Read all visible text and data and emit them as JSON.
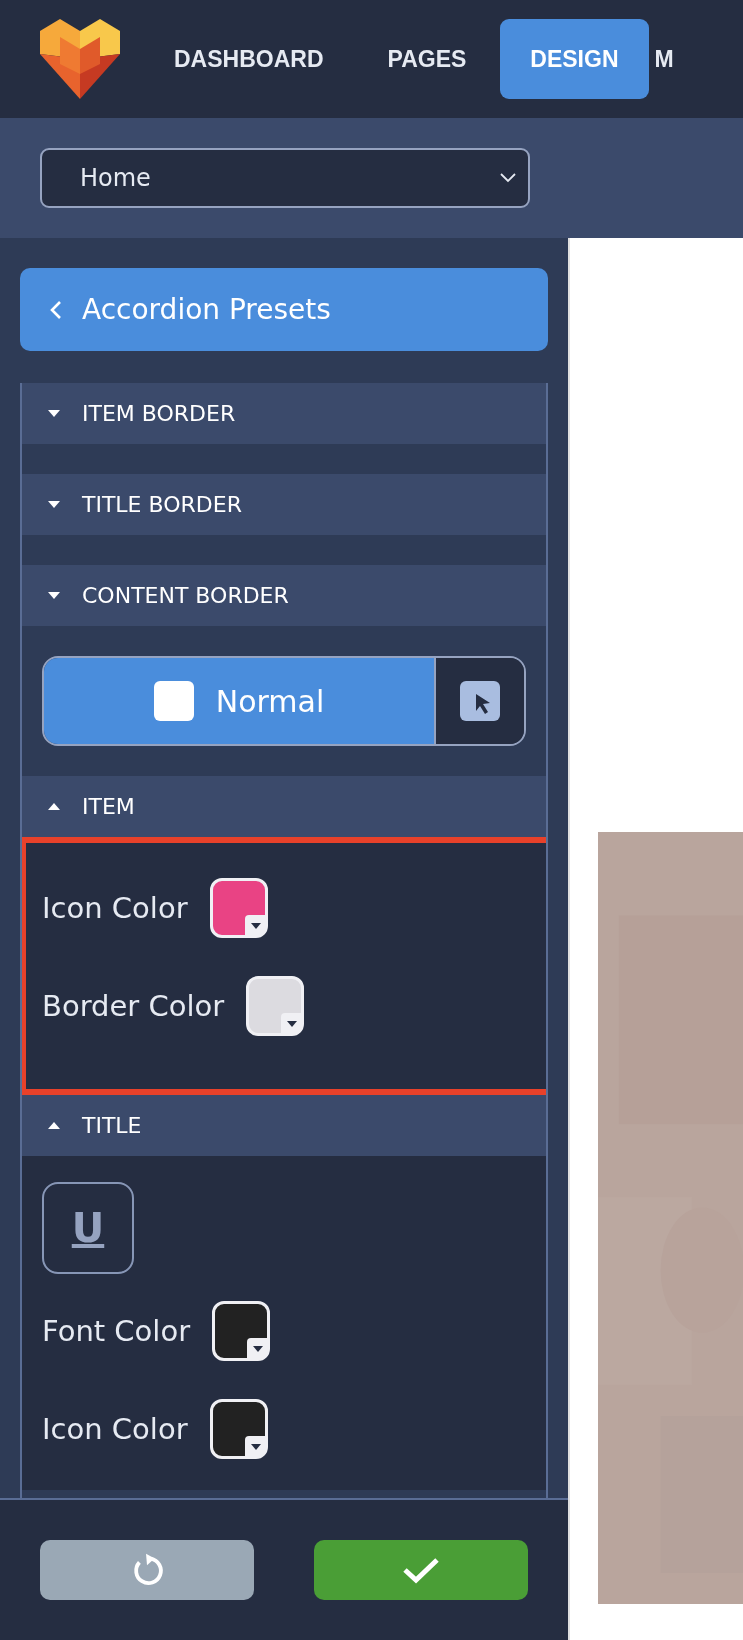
{
  "nav": {
    "items": [
      {
        "label": "DASHBOARD",
        "selected": false
      },
      {
        "label": "PAGES",
        "selected": false
      },
      {
        "label": "DESIGN",
        "selected": true
      },
      {
        "label": "M",
        "selected": false
      }
    ]
  },
  "page_select": {
    "value": "Home"
  },
  "back_button": {
    "label": "Accordion Presets"
  },
  "panel": [
    {
      "kind": "section",
      "title": "ITEM BORDER",
      "expanded": false
    },
    {
      "kind": "section",
      "title": "TITLE BORDER",
      "expanded": false
    },
    {
      "kind": "section",
      "title": "CONTENT BORDER",
      "expanded": false
    },
    {
      "kind": "state_toggle",
      "label": "Normal"
    },
    {
      "kind": "section",
      "title": "ITEM",
      "expanded": true,
      "highlighted": true,
      "controls": [
        {
          "kind": "color",
          "label": "Icon Color",
          "color": "#e94384"
        },
        {
          "kind": "color",
          "label": "Border Color",
          "color": "#dcdbe0"
        }
      ]
    },
    {
      "kind": "section",
      "title": "TITLE",
      "expanded": true,
      "controls": [
        {
          "kind": "format",
          "label": "U"
        },
        {
          "kind": "color",
          "label": "Font Color",
          "color": "#222222"
        },
        {
          "kind": "color",
          "label": "Icon Color",
          "color": "#222222"
        }
      ]
    }
  ]
}
